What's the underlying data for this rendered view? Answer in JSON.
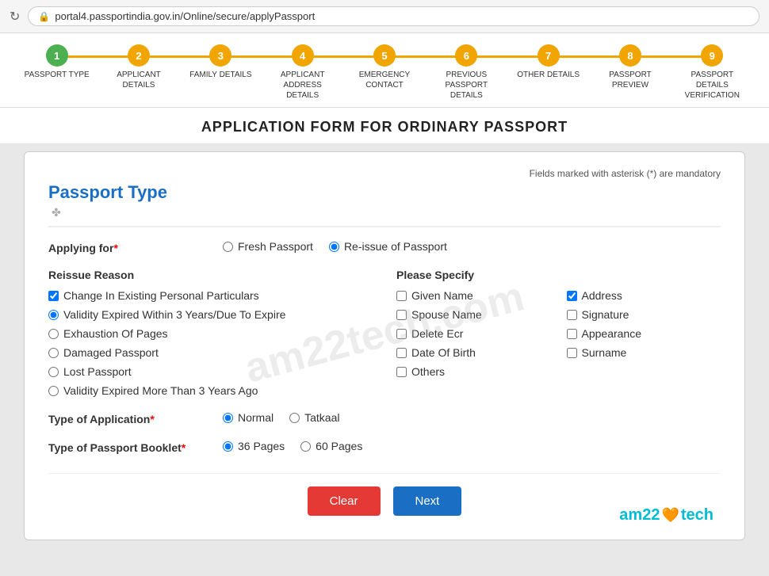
{
  "browser": {
    "url": "portal4.passportindia.gov.in/Online/secure/applyPassport"
  },
  "progress": {
    "steps": [
      {
        "number": "1",
        "label": "PASSPORT TYPE",
        "active": true
      },
      {
        "number": "2",
        "label": "APPLICANT DETAILS",
        "active": false
      },
      {
        "number": "3",
        "label": "FAMILY DETAILS",
        "active": false
      },
      {
        "number": "4",
        "label": "APPLICANT ADDRESS DETAILS",
        "active": false
      },
      {
        "number": "5",
        "label": "EMERGENCY CONTACT",
        "active": false
      },
      {
        "number": "6",
        "label": "PREVIOUS PASSPORT DETAILS",
        "active": false
      },
      {
        "number": "7",
        "label": "OTHER DETAILS",
        "active": false
      },
      {
        "number": "8",
        "label": "PASSPORT PREVIEW",
        "active": false
      },
      {
        "number": "9",
        "label": "PASSPORT DETAILS VERIFICATION",
        "active": false
      }
    ]
  },
  "page": {
    "title": "APPLICATION FORM FOR ORDINARY PASSPORT"
  },
  "form": {
    "mandatory_note": "Fields marked with asterisk (*) are mandatory",
    "section_title": "Passport Type",
    "applying_for": {
      "label": "Applying for",
      "required": true,
      "options": [
        {
          "label": "Fresh Passport",
          "value": "fresh",
          "selected": false
        },
        {
          "label": "Re-issue of Passport",
          "value": "reissue",
          "selected": true
        }
      ]
    },
    "reissue_reason": {
      "label": "Reissue Reason",
      "options": [
        {
          "label": "Change In Existing Personal Particulars",
          "value": "change",
          "checked": true,
          "type": "checkbox"
        },
        {
          "label": "Validity Expired Within 3 Years/Due To Expire",
          "value": "validity3",
          "checked": true,
          "type": "radio"
        },
        {
          "label": "Exhaustion Of Pages",
          "value": "exhaustion",
          "checked": false,
          "type": "radio"
        },
        {
          "label": "Damaged Passport",
          "value": "damaged",
          "checked": false,
          "type": "radio"
        },
        {
          "label": "Lost Passport",
          "value": "lost",
          "checked": false,
          "type": "radio"
        },
        {
          "label": "Validity Expired More Than 3 Years Ago",
          "value": "validity3plus",
          "checked": false,
          "type": "radio"
        }
      ]
    },
    "please_specify": {
      "label": "Please Specify",
      "options": [
        {
          "label": "Given Name",
          "checked": false
        },
        {
          "label": "Spouse Name",
          "checked": false
        },
        {
          "label": "Delete Ecr",
          "checked": false
        },
        {
          "label": "Date Of Birth",
          "checked": false
        },
        {
          "label": "Others",
          "checked": false
        },
        {
          "label": "Address",
          "checked": true
        },
        {
          "label": "Signature",
          "checked": false
        },
        {
          "label": "Appearance",
          "checked": false
        },
        {
          "label": "Surname",
          "checked": false
        }
      ]
    },
    "type_of_application": {
      "label": "Type of Application",
      "required": true,
      "options": [
        {
          "label": "Normal",
          "value": "normal",
          "selected": true
        },
        {
          "label": "Tatkaal",
          "value": "tatkaal",
          "selected": false
        }
      ]
    },
    "type_of_booklet": {
      "label": "Type of Passport Booklet",
      "required": true,
      "options": [
        {
          "label": "36 Pages",
          "value": "36",
          "selected": true
        },
        {
          "label": "60 Pages",
          "value": "60",
          "selected": false
        }
      ]
    },
    "buttons": {
      "clear": "Clear",
      "next": "Next"
    }
  },
  "branding": {
    "text": "am22",
    "emoji": "🧡",
    "text2": "tech"
  }
}
